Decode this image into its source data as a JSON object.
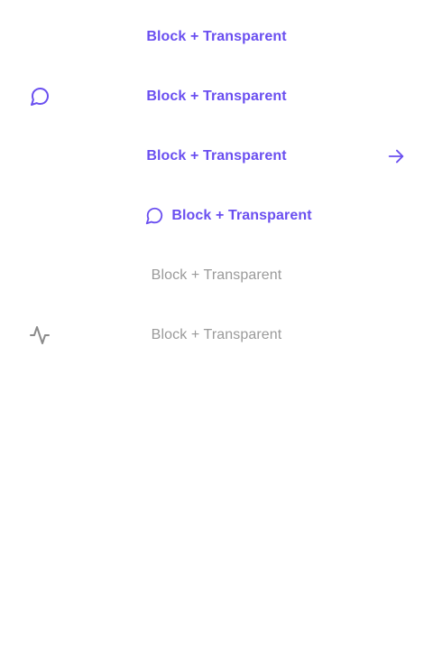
{
  "buttons": [
    {
      "label": "Block + Transparent",
      "state": "active",
      "icon_left": "",
      "icon_right": ""
    },
    {
      "label": "Block + Transparent",
      "state": "active",
      "icon_left": "message-circle-icon",
      "icon_right": ""
    },
    {
      "label": "Block + Transparent",
      "state": "active",
      "icon_left": "",
      "icon_right": "arrow-right-icon"
    },
    {
      "label": "Block + Transparent",
      "state": "active",
      "icon_inline": "message-circle-icon"
    },
    {
      "label": "Block + Transparent",
      "state": "disabled",
      "icon_left": "",
      "icon_right": ""
    },
    {
      "label": "Block + Transparent",
      "state": "disabled",
      "icon_left": "activity-icon",
      "icon_right": ""
    }
  ],
  "colors": {
    "primary": "#6a4ff0",
    "disabled": "#9a9a9a",
    "background": "#ffffff"
  }
}
